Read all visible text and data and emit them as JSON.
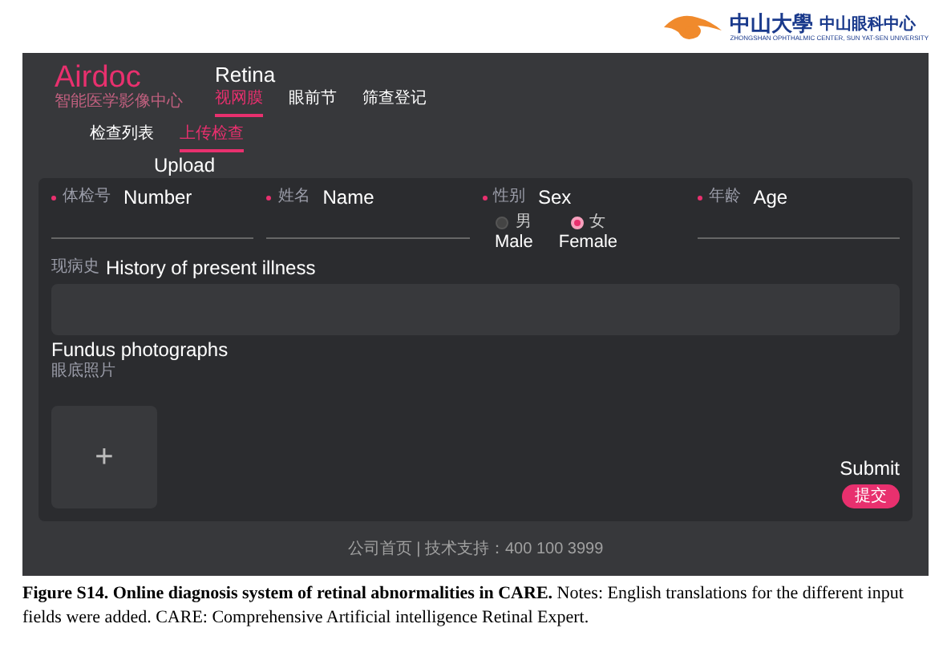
{
  "institution_logo": {
    "name": "中山大學",
    "center": "中山眼科中心",
    "subtitle": "ZHONGSHAN OPHTHALMIC CENTER, SUN YAT-SEN UNIVERSITY"
  },
  "app": {
    "brand": "Airdoc",
    "brand_subtitle": "智能医学影像中心",
    "product": "Retina",
    "nav": [
      {
        "label": "视网膜",
        "selected": true
      },
      {
        "label": "眼前节",
        "selected": false
      },
      {
        "label": "筛查登记",
        "selected": false
      }
    ],
    "subtabs": [
      {
        "label": "检查列表",
        "selected": false
      },
      {
        "label": "上传检查",
        "selected": true
      }
    ],
    "subtab_annotation": "Upload",
    "fields": [
      {
        "kind": "text",
        "label": "体检号",
        "annotation": "Number",
        "required": true
      },
      {
        "kind": "text",
        "label": "姓名",
        "annotation": "Name",
        "required": true
      },
      {
        "kind": "radio",
        "label": "性别",
        "annotation": "Sex",
        "required": true,
        "options": [
          {
            "label": "男",
            "annotation": "Male",
            "selected": false
          },
          {
            "label": "女",
            "annotation": "Female",
            "selected": true
          }
        ]
      },
      {
        "kind": "text",
        "label": "年龄",
        "annotation": "Age",
        "required": true
      }
    ],
    "history": {
      "label": "现病史",
      "annotation": "History of present illness"
    },
    "photos": {
      "annotation": "Fundus photographs",
      "label": "眼底照片",
      "upload_symbol": "+"
    },
    "submit": {
      "annotation": "Submit",
      "label": "提交"
    },
    "footer": "公司首页 | 技术支持：400 100 3999"
  },
  "caption": "**Figure S14. Online diagnosis system of retinal abnormalities in CARE.** Notes: English translations for the different input fields were added. CARE: Comprehensive Artificial intelligence Retinal Expert."
}
